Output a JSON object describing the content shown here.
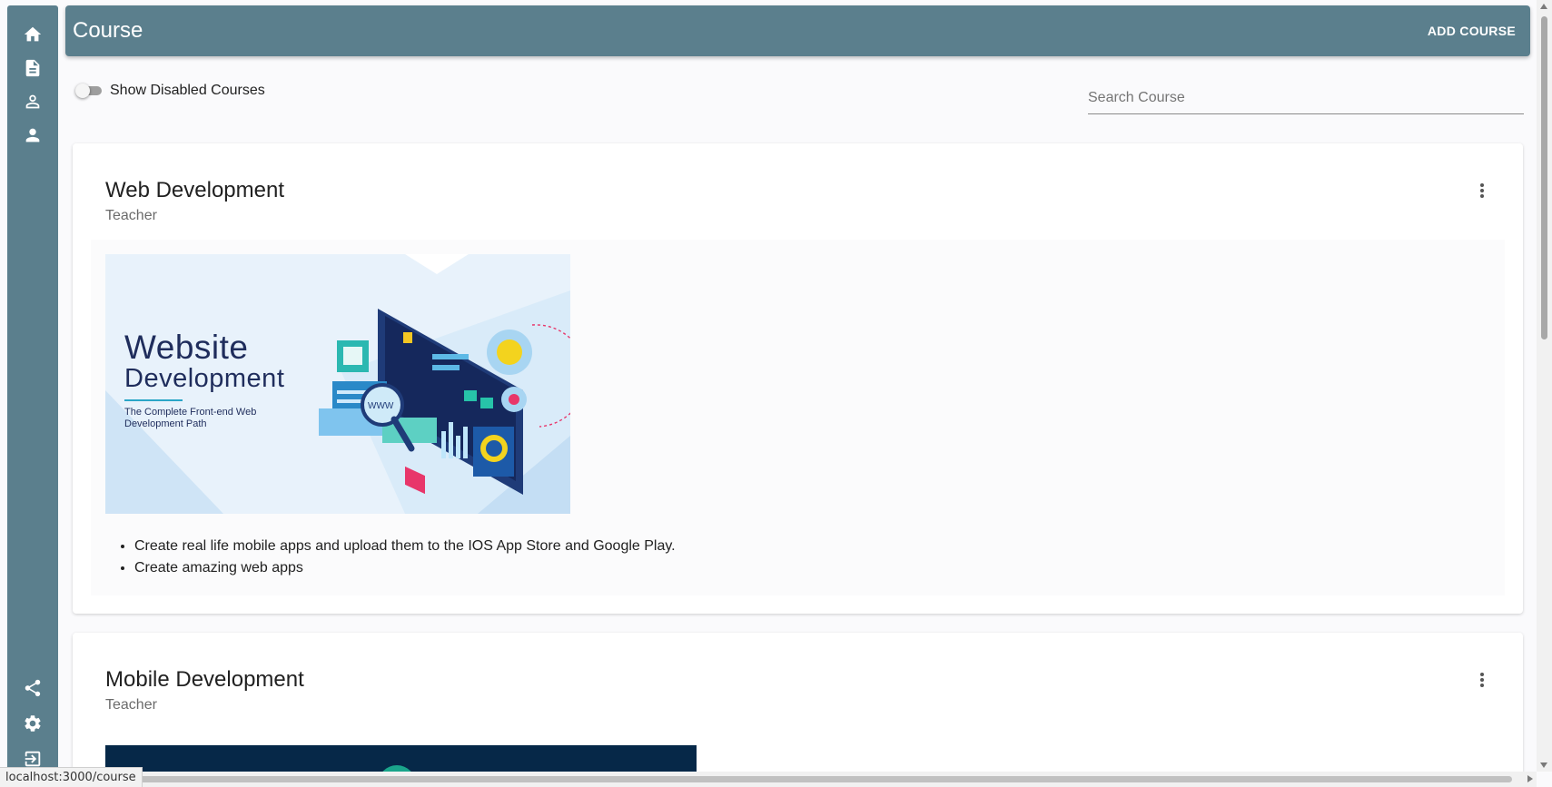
{
  "sidebar": {
    "top_icons": [
      "home-icon",
      "document-icon",
      "person-outline-icon",
      "person-icon"
    ],
    "bottom_icons": [
      "share-icon",
      "settings-icon",
      "logout-icon"
    ]
  },
  "header": {
    "title": "Course",
    "add_button": "ADD COURSE"
  },
  "filters": {
    "toggle_label": "Show Disabled Courses",
    "toggle_on": false,
    "search_placeholder": "Search Course",
    "search_value": ""
  },
  "courses": [
    {
      "title": "Web Development",
      "role": "Teacher",
      "image": {
        "line1": "Website",
        "line2": "Development",
        "tagline": "The Complete Front-end Web Development Path"
      },
      "bullets": [
        "Create real life mobile apps and upload them to the IOS App Store and Google Play.",
        "Create amazing web apps"
      ]
    },
    {
      "title": "Mobile Development",
      "role": "Teacher"
    }
  ],
  "status_bar": {
    "url": "localhost:3000/course"
  },
  "colors": {
    "primary": "#5b7f8d",
    "background": "#fafafc",
    "image_navy": "#1f2d5c",
    "image_teal": "#2aa6c7"
  }
}
